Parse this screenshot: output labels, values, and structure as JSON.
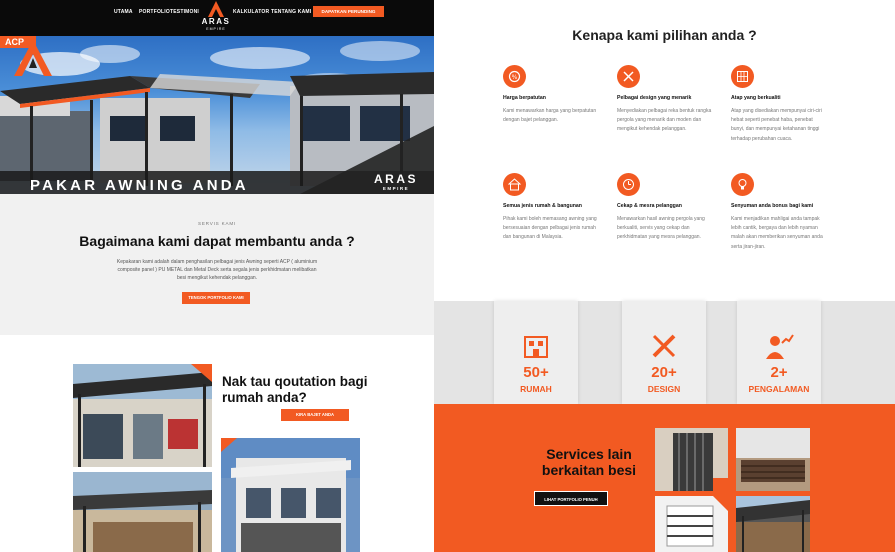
{
  "nav": {
    "items": [
      "UTAMA",
      "PORTFOLIO",
      "TESTIMONI",
      "KALKULATOR",
      "TENTANG KAMI"
    ],
    "cta": "DAPATKAN PERUNDING",
    "logo_text": "ARAS",
    "logo_sub": "EMPIRE"
  },
  "hero": {
    "badge": "ACP",
    "headline": "PAKAR AWNING ANDA",
    "brand": "ARAS",
    "brand_sub": "EMPIRE"
  },
  "services": {
    "label": "SERVIS KAMI",
    "title": "Bagaimana kami dapat membantu anda ?",
    "description": "Kepakaran kami adalah dalam penghasilan pelbagai jenis Awning seperti ACP ( aluminium composite panel ) PU METAL dan Metal Deck serta segala jenis perkhidmatan melibatkan besi mengikut kehendak pelanggan.",
    "button": "TENGOK PORTFOLIO KAMI"
  },
  "quotation": {
    "title": "Nak tau qoutation bagi rumah anda?",
    "button": "KIRA BAJET ANDA"
  },
  "why": {
    "title": "Kenapa kami pilihan anda ?",
    "features": [
      {
        "icon": "price-tag-icon",
        "title": "Harga berpatutan",
        "text": "Kami menawarkan harga yang berpatutan dengan bajet pelanggan."
      },
      {
        "icon": "design-tools-icon",
        "title": "Pelbagai design yang menarik",
        "text": "Menyediakan pelbagai reka bentuk rangka pergola yang menarik dan moden dan mengikut kehendak pelanggan."
      },
      {
        "icon": "roof-grid-icon",
        "title": "Atap yang berkualiti",
        "text": "Atap yang disediakan mempunyai ciri-ciri hebat seperti penebat haba, penebat bunyi, dan mempunyai ketahanan tinggi terhadap perubahan cuaca."
      },
      {
        "icon": "house-plan-icon",
        "title": "Semua jenis rumah & bangunan",
        "text": "Pihak kami boleh memasang awning yang bersesuaian dengan pelbagai jenis rumah dan bangunan di Malaysia."
      },
      {
        "icon": "fast-service-icon",
        "title": "Cekap & mesra pelanggan",
        "text": "Menawarkan hasil awning pergola yang berkualiti, servis yang cekap dan perkhidmatan yang mesra pelanggan."
      },
      {
        "icon": "lightbulb-icon",
        "title": "Senyuman anda bonus bagi kami",
        "text": "Kami menjadikan mahligai anda tampak lebih cantik, bergaya dan lebih nyaman malah akan memberikan senyuman anda serta jiran-jiran."
      }
    ]
  },
  "stats": [
    {
      "number": "50+",
      "label": "RUMAH",
      "icon": "building-icon"
    },
    {
      "number": "20+",
      "label": "DESIGN",
      "icon": "ruler-pencil-icon"
    },
    {
      "number": "2+",
      "label": "PENGALAMAN",
      "icon": "worker-growth-icon"
    }
  ],
  "other": {
    "title": "Services lain berkaitan besi",
    "button": "LIHAT PORTFOLIO PENUH"
  },
  "colors": {
    "accent": "#f25a22",
    "nav_bg": "#0a0a0a",
    "services_bg": "#f1f1f1"
  }
}
